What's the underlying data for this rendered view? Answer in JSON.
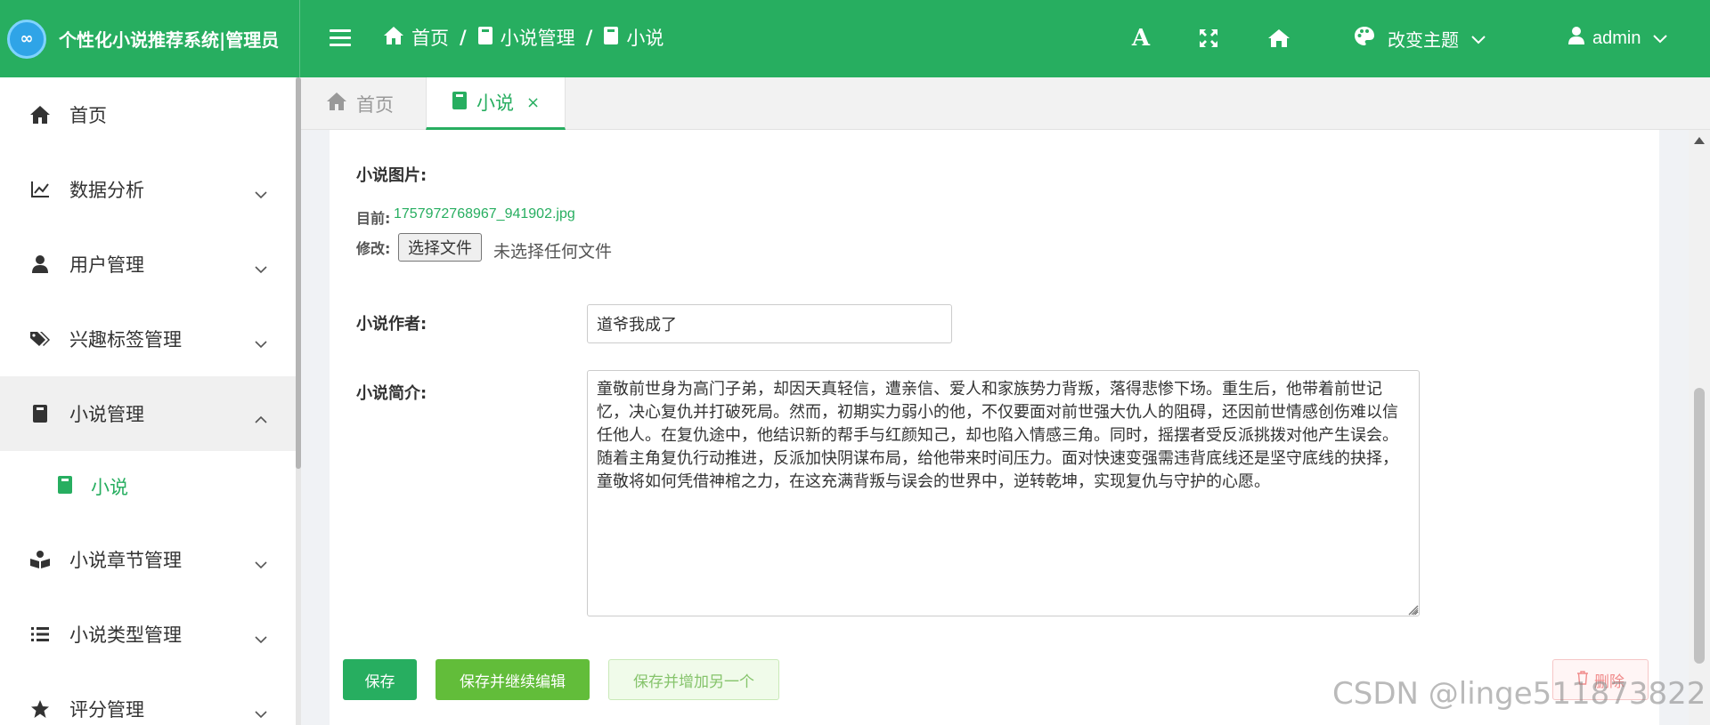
{
  "app": {
    "title": "个性化小说推荐系统|管理员"
  },
  "header": {
    "breadcrumb": [
      {
        "label": "首页",
        "icon": "home-icon"
      },
      {
        "label": "小说管理",
        "icon": "book-icon"
      },
      {
        "label": "小说",
        "icon": "book-icon"
      }
    ],
    "breadcrumb_sep": "/",
    "font_icon_label": "A",
    "theme_label": "改变主题",
    "user_label": "admin"
  },
  "sidebar": {
    "items": [
      {
        "label": "首页",
        "icon": "home-icon"
      },
      {
        "label": "数据分析",
        "icon": "line-chart-icon"
      },
      {
        "label": "用户管理",
        "icon": "user-icon"
      },
      {
        "label": "兴趣标签管理",
        "icon": "tags-icon"
      },
      {
        "label": "小说管理",
        "icon": "book-icon",
        "open": true
      },
      {
        "label": "小说",
        "icon": "book-icon",
        "sub": true,
        "active": true
      },
      {
        "label": "小说章节管理",
        "icon": "reader-icon"
      },
      {
        "label": "小说类型管理",
        "icon": "list-icon"
      },
      {
        "label": "评分管理",
        "icon": "star-icon"
      }
    ]
  },
  "tabs": [
    {
      "label": "首页",
      "icon": "home-icon",
      "active": false
    },
    {
      "label": "小说",
      "icon": "book-icon",
      "active": true,
      "close": "×"
    }
  ],
  "form": {
    "image_label": "小说图片:",
    "current_label": "目前:",
    "current_file": "1757972768967_941902.jpg",
    "modify_label": "修改:",
    "choose_file_label": "选择文件",
    "no_file_label": "未选择任何文件",
    "author_label": "小说作者:",
    "author_value": "道爷我成了",
    "intro_label": "小说简介:",
    "intro_value": "童敬前世身为高门子弟，却因天真轻信，遭亲信、爱人和家族势力背叛，落得悲惨下场。重生后，他带着前世记忆，决心复仇并打破死局。然而，初期实力弱小的他，不仅要面对前世强大仇人的阻碍，还因前世情感创伤难以信任他人。在复仇途中，他结识新的帮手与红颜知己，却也陷入情感三角。同时，摇摆者受反派挑拨对他产生误会。随着主角复仇行动推进，反派加快阴谋布局，给他带来时间压力。面对快速变强需违背底线还是坚守底线的抉择，童敬将如何凭借神棺之力，在这充满背叛与误会的世界中，逆转乾坤，实现复仇与守护的心愿。"
  },
  "buttons": {
    "save": "保存",
    "save_continue": "保存并继续编辑",
    "save_add": "保存并增加另一个",
    "delete": "删除"
  },
  "watermark": "CSDN @linge511873822",
  "colors": {
    "primary": "#27ae60",
    "secondary_green": "#62bd3a",
    "danger": "#f08c8c"
  }
}
